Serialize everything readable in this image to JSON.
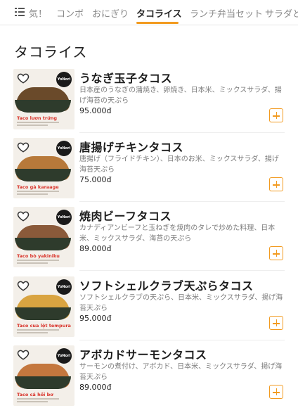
{
  "tabs": [
    {
      "label": "気！"
    },
    {
      "label": "コンボ"
    },
    {
      "label": "おにぎり"
    },
    {
      "label": "タコライス",
      "active": true
    },
    {
      "label": "ランチ弁当セット"
    },
    {
      "label": "サラダと"
    }
  ],
  "section_title": "タコライス",
  "icons": {
    "menu": "menu-list-icon",
    "favorite": "heart-outline-icon",
    "add": "plus-icon"
  },
  "colors": {
    "accent": "#f29a1f",
    "caption": "#d9342b"
  },
  "items": [
    {
      "name": "うなぎ玉子タコス",
      "description": "日本産のうなぎの蒲焼き、卵焼き、日本米、ミックスサラダ、揚げ海苔の天ぷら",
      "price": "95.000đ",
      "image_caption": "Taco lươn trứng",
      "brand": "YoNori",
      "filling_color": "#6a4a2a"
    },
    {
      "name": "唐揚げチキンタコス",
      "description": "唐揚げ（フライドチキン）、日本のお米、ミックスサラダ、揚げ海苔天ぷら",
      "price": "75.000đ",
      "image_caption": "Taco gà karaage",
      "brand": "YoNori",
      "filling_color": "#b7793a"
    },
    {
      "name": "焼肉ビーフタコス",
      "description": "カナディアンビーフと玉ねぎを焼肉のタレで炒めた料理、日本米、ミックスサラダ、海苔の天ぷら",
      "price": "89.000đ",
      "image_caption": "Taco bò yakiniku",
      "brand": "YoNori",
      "filling_color": "#8a5a3a"
    },
    {
      "name": "ソフトシェルクラブ天ぷらタコス",
      "description": "ソフトシェルクラブの天ぷら、日本米、ミックスサラダ、揚げ海苔天ぷら",
      "price": "95.000đ",
      "image_caption": "Taco cua lột tempura",
      "brand": "YoNori",
      "filling_color": "#d9a441"
    },
    {
      "name": "アボカドサーモンタコス",
      "description": "サーモンの煮付け、アボカド、日本米、ミックスサラダ、揚げ海苔天ぷら",
      "price": "89.000đ",
      "image_caption": "Taco cá hồi bơ",
      "brand": "YoNori",
      "filling_color": "#c4773e"
    }
  ]
}
